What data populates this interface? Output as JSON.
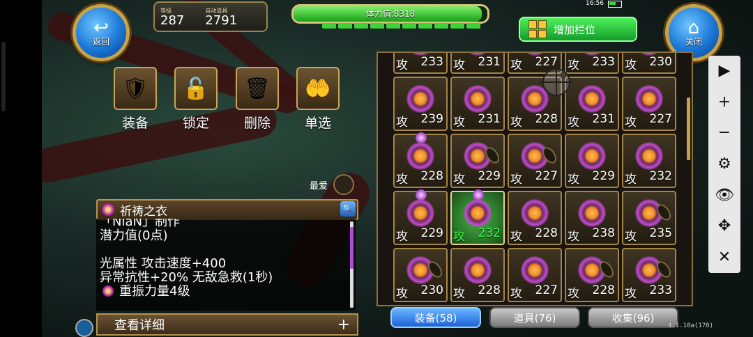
{
  "top": {
    "back_label": "返回",
    "close_label": "关闭",
    "level_label": "等级",
    "level_value": "287",
    "auto_item_label": "自动道具",
    "auto_item_value": "2791",
    "stamina_text": "体力值:8318",
    "stamina_fill": 0.97,
    "add_slot_label": "增加栏位",
    "clock": "16:56"
  },
  "actions": [
    {
      "label": "装备",
      "icon": "armor-icon"
    },
    {
      "label": "锁定",
      "icon": "lock-icon"
    },
    {
      "label": "删除",
      "icon": "trash-icon"
    },
    {
      "label": "单选",
      "icon": "hand-icon"
    }
  ],
  "favorite_label": "最爱",
  "detail": {
    "item_name": "祈祷之衣",
    "lines": [
      "「NiaN」制作",
      "潜力值(0点)",
      "",
      "光属性 攻击速度+400",
      "异常抗性+20% 无敌急救(1秒)"
    ],
    "resonance": "重振力量4级",
    "view_more": "查看详细"
  },
  "inventory": {
    "atk_label": "攻",
    "items": [
      {
        "atk": "233"
      },
      {
        "atk": "231"
      },
      {
        "atk": "227"
      },
      {
        "atk": "233"
      },
      {
        "atk": "230"
      },
      {
        "atk": "239"
      },
      {
        "atk": "231"
      },
      {
        "atk": "228"
      },
      {
        "atk": "231"
      },
      {
        "atk": "227"
      },
      {
        "atk": "228",
        "gem": true
      },
      {
        "atk": "229",
        "seed": true
      },
      {
        "atk": "227",
        "seed": true
      },
      {
        "atk": "229"
      },
      {
        "atk": "232"
      },
      {
        "atk": "229",
        "gem": true
      },
      {
        "atk": "232",
        "gem": true,
        "selected": true
      },
      {
        "atk": "228"
      },
      {
        "atk": "238"
      },
      {
        "atk": "235",
        "seed": true
      },
      {
        "atk": "230",
        "seed": true
      },
      {
        "atk": "228"
      },
      {
        "atk": "227"
      },
      {
        "atk": "228",
        "seed": true
      },
      {
        "atk": "233",
        "seed": true
      }
    ]
  },
  "tabs": [
    {
      "label": "装备(58)",
      "active": true
    },
    {
      "label": "道具(76)",
      "active": false
    },
    {
      "label": "收集(96)",
      "active": false
    }
  ],
  "version": "4.1.10a(170)",
  "toolbar": [
    "▶",
    "+",
    "−",
    "⚙",
    "👁",
    "✥",
    "✕"
  ]
}
